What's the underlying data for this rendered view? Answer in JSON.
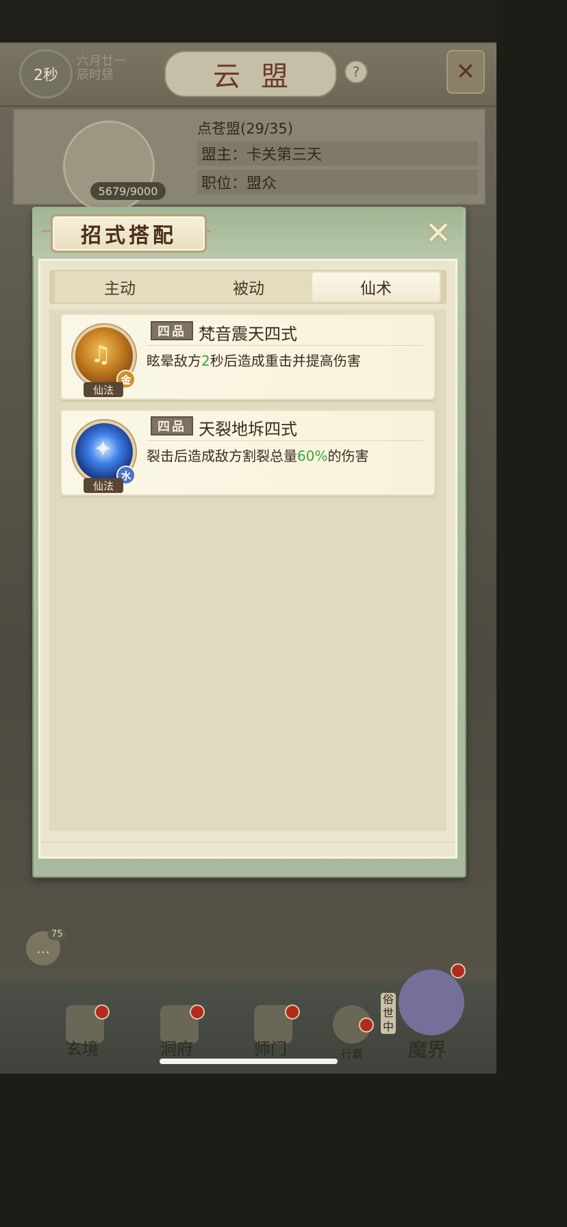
{
  "background": {
    "timer": "2秒",
    "date_line1": "六月廿一",
    "date_line2": "辰时昼",
    "title": "云盟",
    "help_symbol": "?",
    "alliance": {
      "name": "点苍盟(29/35)",
      "leader": "盟主：卡关第三天",
      "position": "职位：盟众",
      "exp": "5679/9000"
    },
    "chat_badge": "75",
    "nav": [
      {
        "label": "玄境"
      },
      {
        "label": "洞府"
      },
      {
        "label": "师门"
      },
      {
        "label": "行囊"
      },
      {
        "label": "魔界"
      }
    ],
    "side_label": "俗世中"
  },
  "modal": {
    "title": "招式搭配",
    "tabs": [
      {
        "label": "主动",
        "active": false
      },
      {
        "label": "被动",
        "active": false
      },
      {
        "label": "仙术",
        "active": true
      }
    ],
    "skills": [
      {
        "grade": "四品",
        "name": "梵音震天四式",
        "desc_before": "眩晕敌方",
        "desc_highlight": "2",
        "desc_after": "秒后造成重击并提高伤害",
        "type_label": "仙法",
        "element": "金",
        "icon": "music-note-icon"
      },
      {
        "grade": "四品",
        "name": "天裂地坼四式",
        "desc_before": "裂击后造成敌方割裂总量",
        "desc_highlight": "60%",
        "desc_after": "的伤害",
        "type_label": "仙法",
        "element": "水",
        "icon": "ice-shard-icon"
      }
    ]
  },
  "colors": {
    "highlight_green": "#3aa33a",
    "modal_frame": "#b9c7ad",
    "card_bg": "#fbf7e6"
  }
}
